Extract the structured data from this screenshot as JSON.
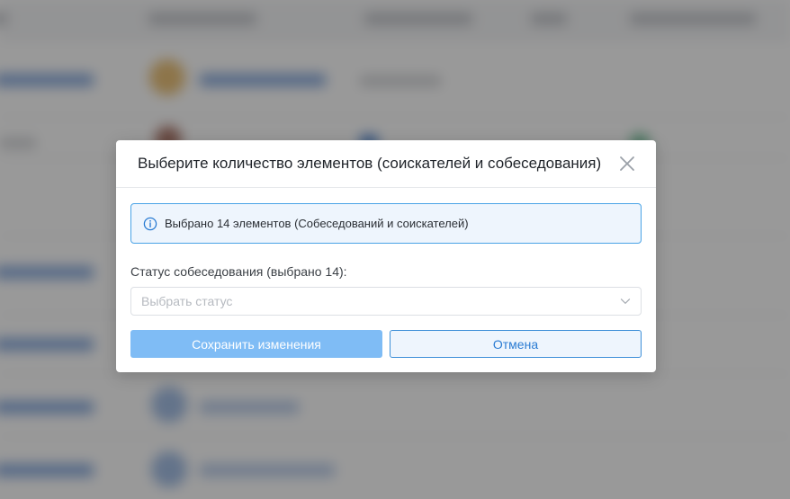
{
  "theme": {
    "accent": "#2b7cd3",
    "info_border": "#4aa3e6",
    "info_bg": "#eef5fd",
    "save_bg": "#7fbcf5"
  },
  "modal": {
    "title": "Выберите количество элементов (соискателей и собеседования)",
    "close_icon": "close-icon",
    "info": {
      "icon": "info-icon",
      "text": "Выбрано 14 элементов (Собеседований и соискателей)"
    },
    "status_field": {
      "label": "Статус собеседования (выбрано 14):",
      "value": "",
      "placeholder": "Выбрать статус",
      "icon": "chevron-down-icon"
    },
    "buttons": {
      "save_label": "Сохранить изменения",
      "cancel_label": "Отмена"
    }
  }
}
